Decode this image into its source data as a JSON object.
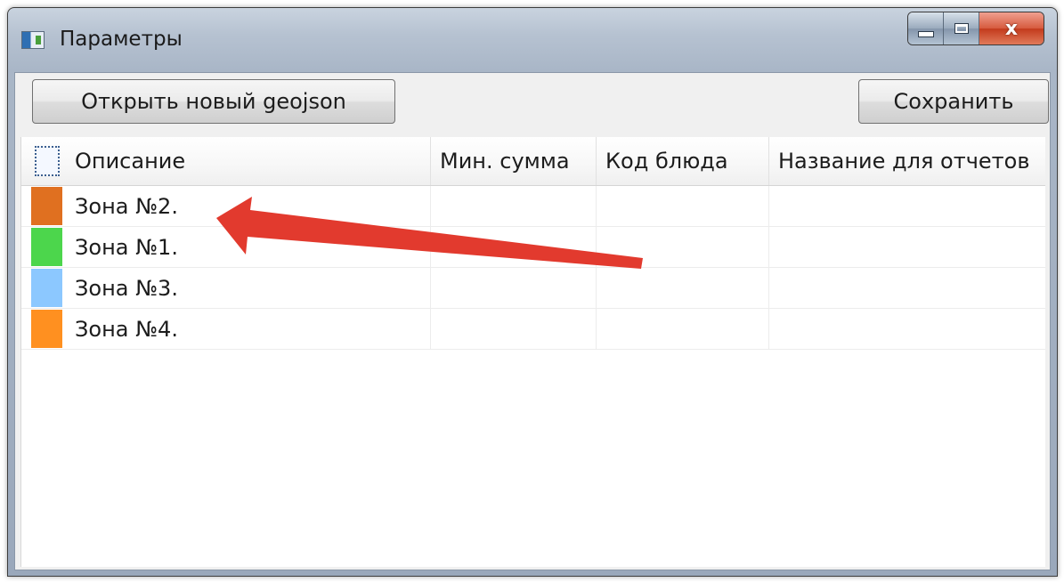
{
  "window": {
    "title": "Параметры",
    "close_glyph": "x"
  },
  "toolbar": {
    "open_label": "Открыть новый geojson",
    "save_label": "Сохранить"
  },
  "table": {
    "columns": [
      "Описание",
      "Мин. сумма",
      "Код блюда",
      "Название для отчетов"
    ],
    "rows": [
      {
        "description": "Зона №2.",
        "min_sum": "",
        "dish_code": "",
        "report_name": "",
        "color": "#e07020"
      },
      {
        "description": "Зона №1.",
        "min_sum": "",
        "dish_code": "",
        "report_name": "",
        "color": "#4cd64c"
      },
      {
        "description": "Зона №3.",
        "min_sum": "",
        "dish_code": "",
        "report_name": "",
        "color": "#8cc8ff"
      },
      {
        "description": "Зона №4.",
        "min_sum": "",
        "dish_code": "",
        "report_name": "",
        "color": "#ff9020"
      }
    ]
  },
  "annotation": {
    "arrow_color": "#e23a2e",
    "arrow_target": "Зона №2."
  },
  "icons": {
    "app": "app-window-icon",
    "minimize": "minimize-icon",
    "maximize": "maximize-icon",
    "close": "close-icon"
  }
}
